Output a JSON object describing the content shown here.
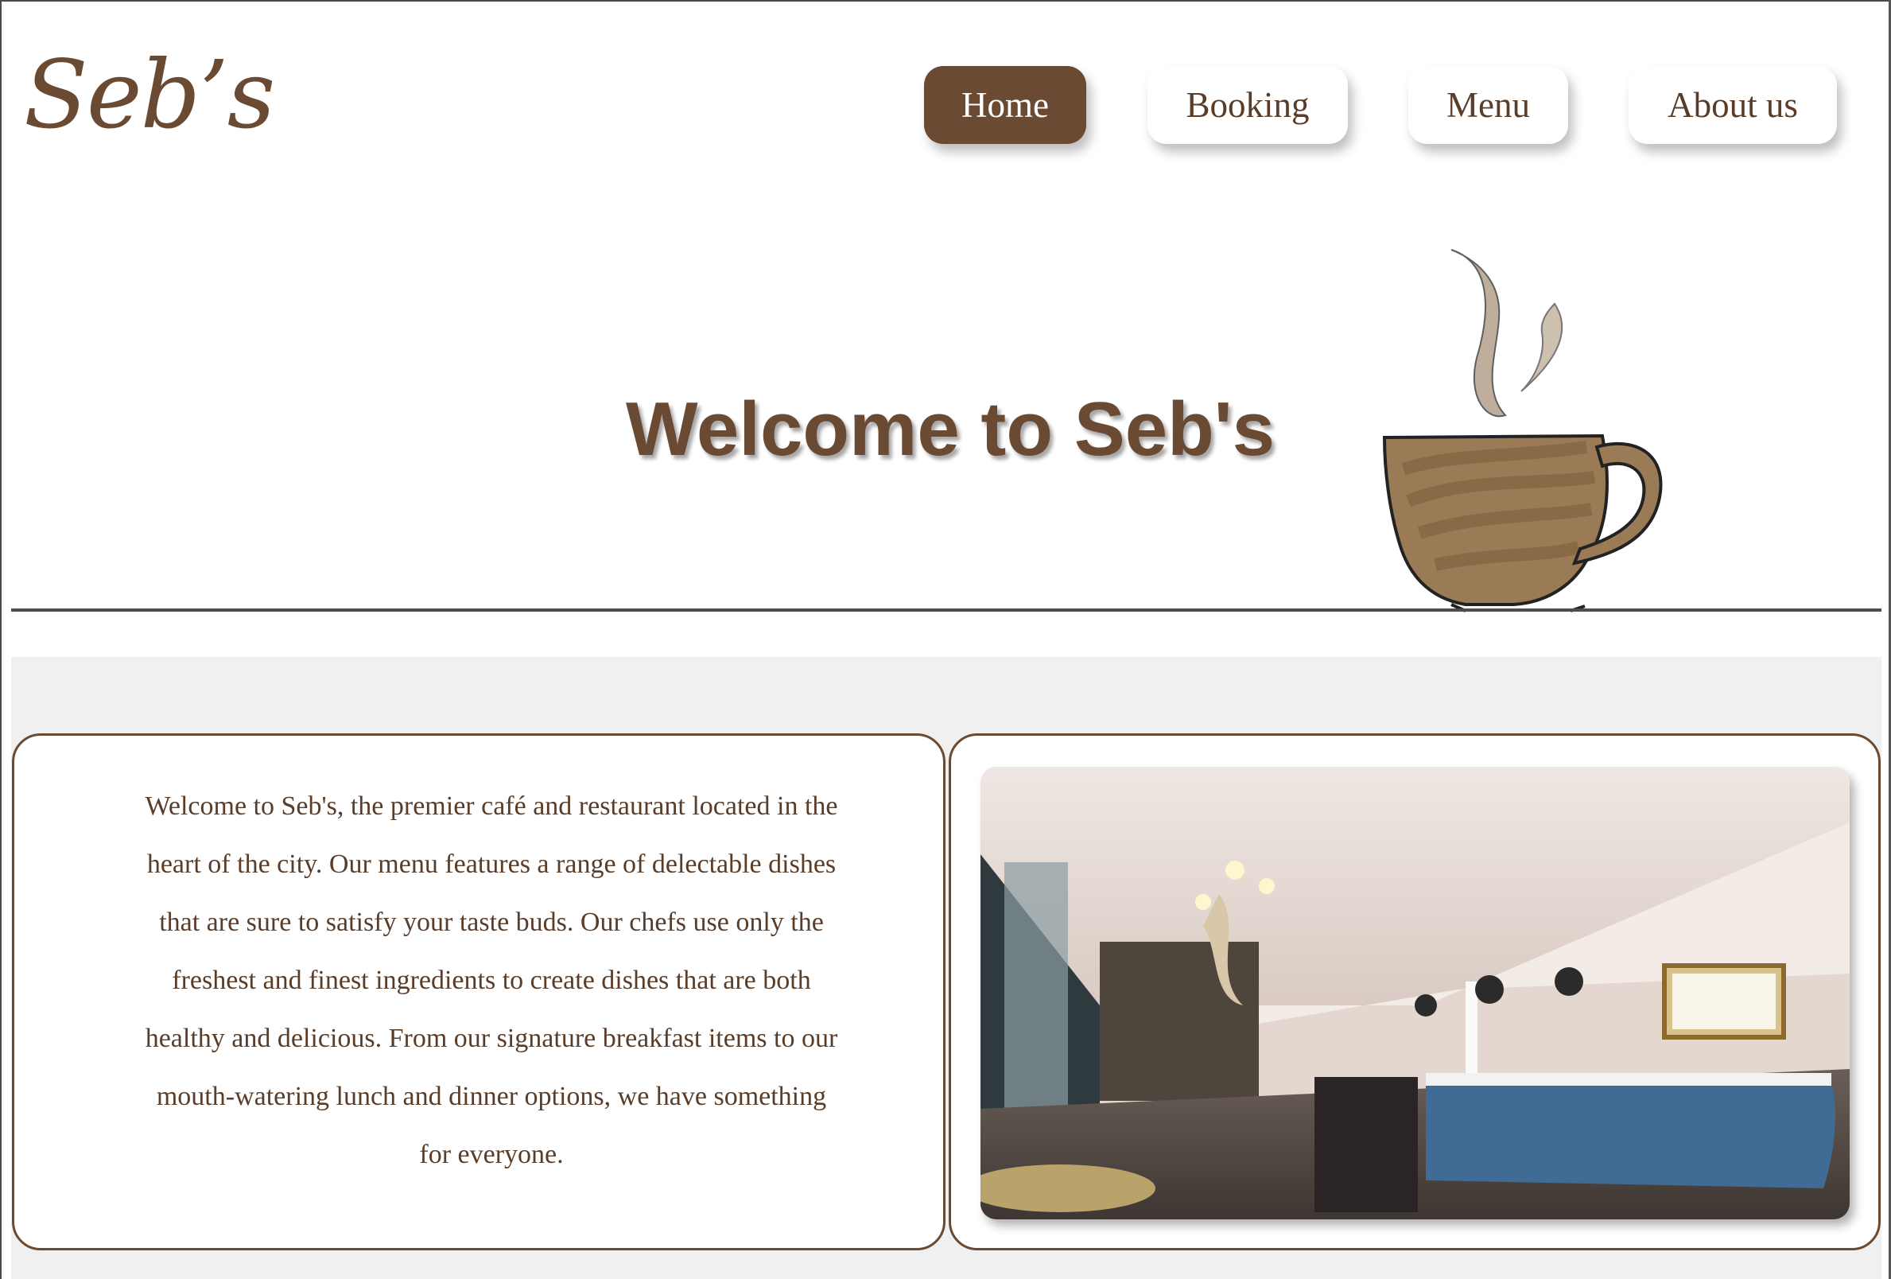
{
  "brand": {
    "logo_text": "Seb’s",
    "primary_color": "#6b4a33",
    "text_color": "#5a3d29"
  },
  "nav": {
    "items": [
      {
        "label": "Home",
        "active": true
      },
      {
        "label": "Booking",
        "active": false
      },
      {
        "label": "Menu",
        "active": false
      },
      {
        "label": "About us",
        "active": false
      }
    ]
  },
  "hero": {
    "title": "Welcome to Seb's",
    "icon": "coffee-cup-icon"
  },
  "intro": {
    "text": "Welcome to Seb's, the premier café and restaurant located in the heart of the city. Our menu features a range of delectable dishes that are sure to satisfy your taste buds. Our chefs use only the freshest and finest ingredients to create dishes that are both healthy and delicious. From our signature breakfast items to our mouth-watering lunch and dinner options, we have something for everyone."
  },
  "photo": {
    "icon": "restaurant-interior-image"
  }
}
